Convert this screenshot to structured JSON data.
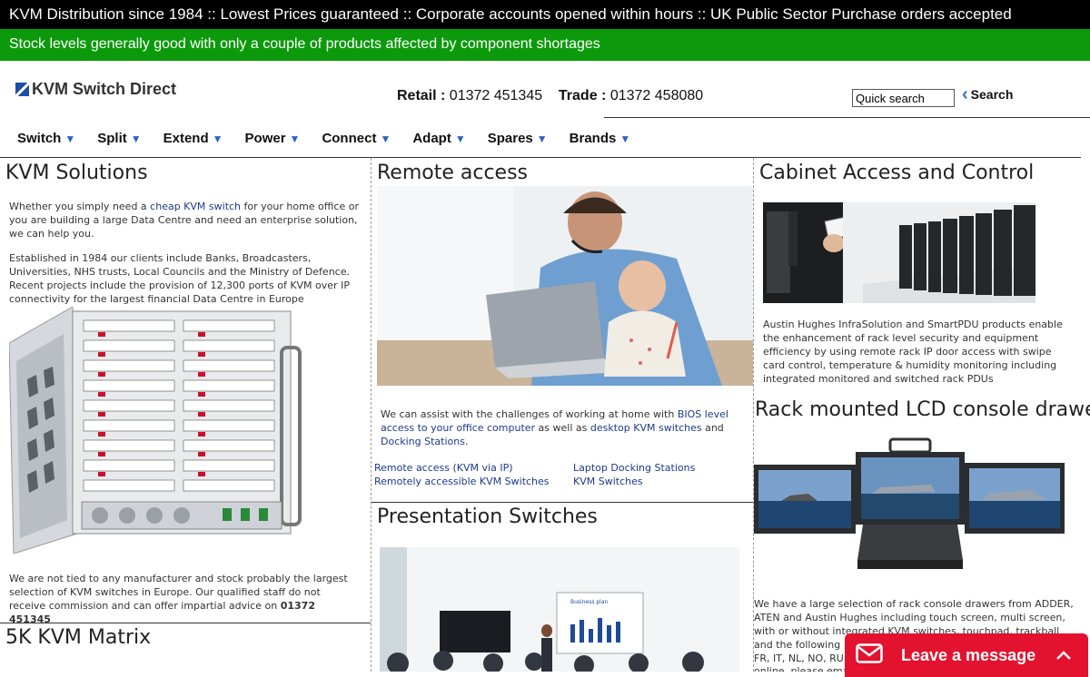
{
  "topbar": {
    "text": "KVM Distribution since 1984 :: Lowest Prices guaranteed :: Corporate accounts opened within hours :: UK Public Sector Purchase orders accepted"
  },
  "stockbar": {
    "text": "Stock levels generally good with only a couple of products affected by component shortages"
  },
  "header": {
    "logo_text": "KVM Switch Direct",
    "retail_label": "Retail :",
    "retail_phone": "01372 451345",
    "trade_label": "Trade :",
    "trade_phone": "01372 458080",
    "search_placeholder": "Quick search",
    "search_label": "Search"
  },
  "nav": {
    "items": [
      "Switch",
      "Split",
      "Extend",
      "Power",
      "Connect",
      "Adapt",
      "Spares",
      "Brands"
    ]
  },
  "kvm_solutions": {
    "title": "KVM Solutions",
    "p1_a": "Whether you simply need a ",
    "p1_link": "cheap KVM switch",
    "p1_b": " for your home office or you are building a large Data Centre and need an enterprise solution, we can help you.",
    "p2": "Established in 1984 our clients include Banks, Broadcasters, Universities, NHS trusts, Local Councils and the Ministry of Defence. Recent projects include the provision of 12,300 ports of KVM over IP connectivity for the largest financial Data Centre in Europe",
    "p3_a": "We are not tied to any manufacturer and stock probably the largest selection of KVM switches in Europe. Our qualified staff do not receive commission and can offer impartial advice on ",
    "p3_phone": "01372 451345"
  },
  "matrix": {
    "title": "5K KVM Matrix"
  },
  "remote": {
    "title": "Remote access",
    "p_a": "We can assist with the challenges of working at home with ",
    "p_link1": "BIOS level access to your office computer",
    "p_b": " as well as ",
    "p_link2": "desktop KVM switches",
    "p_c": " and ",
    "p_link3": "Docking Stations",
    "p_d": ".",
    "links": [
      "Remote access (KVM via IP)",
      "Laptop Docking Stations",
      "Remotely accessible KVM Switches",
      "KVM Switches"
    ]
  },
  "presentation": {
    "title": "Presentation Switches",
    "screen_title": "Business plan"
  },
  "cabinet": {
    "title": "Cabinet Access and Control",
    "p": "Austin Hughes InfraSolution and SmartPDU products enable the enhancement of rack level security and equipment efficiency by using remote rack IP door access with swipe card control, temperature & humidity monitoring including integrated monitored and switched rack PDUs"
  },
  "rack": {
    "title": "Rack mounted LCD console drawers",
    "p": "We have a large selection of rack console drawers from ADDER, ATEN and Austin Hughes including touch screen, multi screen, with or without integrated KVM switches, touchpad, trackball and the following",
    "p_tail1": "FR, IT, NL, NO, RU",
    "p_tail2": "online, please ema"
  },
  "chat": {
    "label": "Leave a message"
  },
  "colors": {
    "topbar": "#000000",
    "stockbar": "#0c9a0c",
    "link": "#1d3a8c",
    "nav_arrow": "#2a62c6",
    "chat": "#e3122e"
  }
}
